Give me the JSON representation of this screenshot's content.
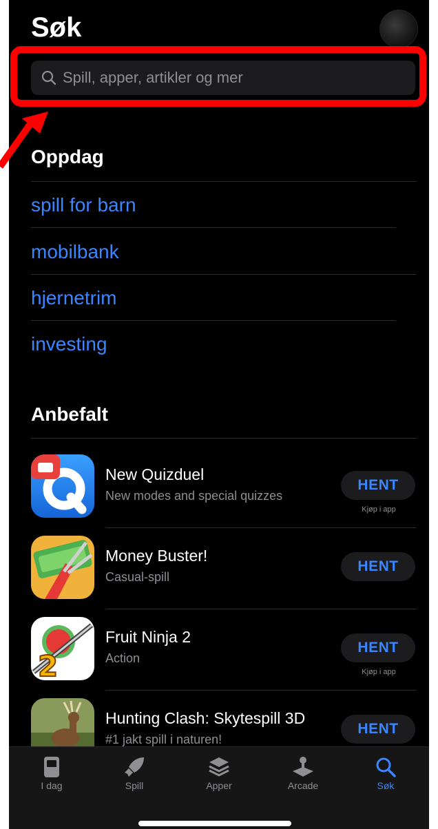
{
  "header": {
    "title": "Søk"
  },
  "search": {
    "placeholder": "Spill, apper, artikler og mer"
  },
  "discover": {
    "title": "Oppdag",
    "items": [
      "spill for barn",
      "mobilbank",
      "hjernetrim",
      "investing"
    ]
  },
  "recommended": {
    "title": "Anbefalt",
    "apps": [
      {
        "name": "New Quizduel",
        "subtitle": "New modes and special quizzes",
        "button": "HENT",
        "iap": "Kjøp i app"
      },
      {
        "name": "Money Buster!",
        "subtitle": "Casual-spill",
        "button": "HENT",
        "iap": ""
      },
      {
        "name": "Fruit Ninja 2",
        "subtitle": "Action",
        "button": "HENT",
        "iap": "Kjøp i app"
      },
      {
        "name": "Hunting Clash: Skytespill 3D",
        "subtitle": "#1 jakt spill i naturen!",
        "button": "HENT",
        "iap": ""
      }
    ]
  },
  "tabs": [
    {
      "label": "I dag",
      "icon": "today-icon"
    },
    {
      "label": "Spill",
      "icon": "rocket-icon"
    },
    {
      "label": "Apper",
      "icon": "layers-icon"
    },
    {
      "label": "Arcade",
      "icon": "joystick-icon"
    },
    {
      "label": "Søk",
      "icon": "search-icon",
      "active": true
    }
  ],
  "colors": {
    "accent": "#3a86ff",
    "highlight": "#ff0000",
    "background": "#000000"
  }
}
